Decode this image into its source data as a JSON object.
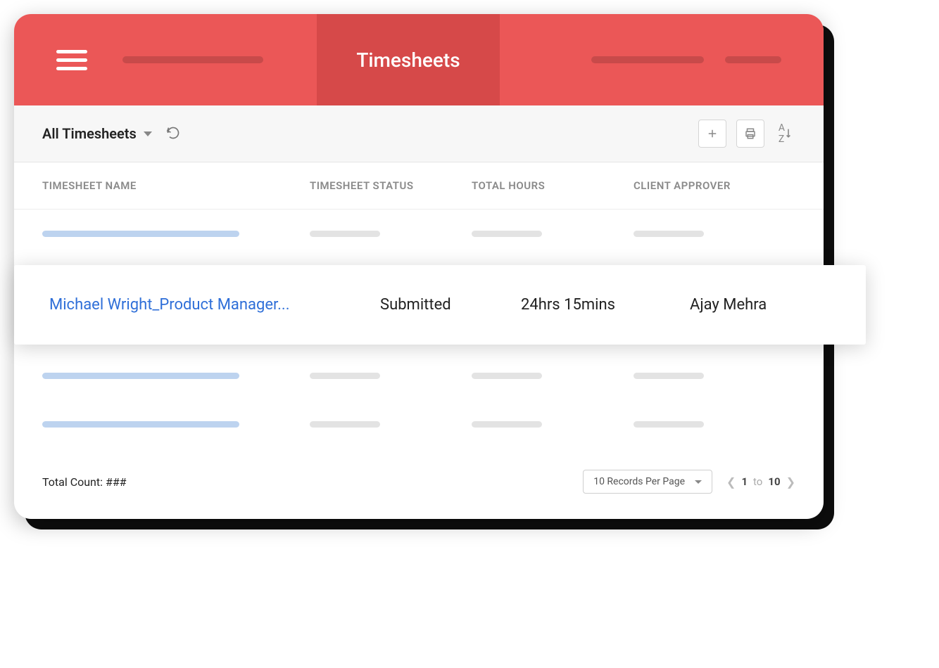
{
  "header": {
    "title": "Timesheets"
  },
  "toolbar": {
    "filter_label": "All Timesheets"
  },
  "columns": {
    "name": "TIMESHEET NAME",
    "status": "TIMESHEET STATUS",
    "hours": "TOTAL HOURS",
    "approver": "CLIENT APPROVER"
  },
  "highlighted_row": {
    "name": "Michael Wright_Product Manager...",
    "status": "Submitted",
    "hours": "24hrs 15mins",
    "approver": "Ajay Mehra"
  },
  "footer": {
    "total_count_label": "Total Count: ###",
    "page_size_label": "10 Records Per Page",
    "page_from": "1",
    "page_to_word": "to",
    "page_to": "10"
  }
}
